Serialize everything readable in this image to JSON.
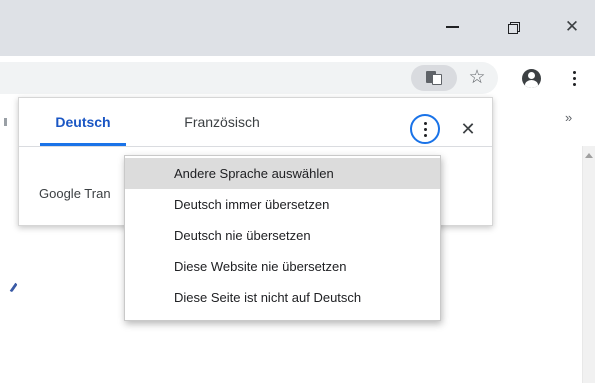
{
  "window_controls": {
    "minimize_icon": "minimize-icon",
    "restore_icon": "restore-icon",
    "close_glyph": "✕"
  },
  "toolbar": {
    "translate_icon": "translate-icon",
    "star_glyph": "☆",
    "profile_icon": "account-icon",
    "menu_icon": "more-vert-icon",
    "bookmarks_overflow": "»"
  },
  "translate_bubble": {
    "tabs": [
      {
        "label": "Deutsch",
        "selected": true
      },
      {
        "label": "Französisch",
        "selected": false
      }
    ],
    "close_glyph": "✕",
    "footer_text": "Google Tran",
    "accent_color": "#1a73e8"
  },
  "options_menu": {
    "items": [
      {
        "label": "Andere Sprache auswählen",
        "highlighted": true
      },
      {
        "label": "Deutsch immer übersetzen",
        "highlighted": false
      },
      {
        "label": "Deutsch nie übersetzen",
        "highlighted": false
      },
      {
        "label": "Diese Website nie übersetzen",
        "highlighted": false
      },
      {
        "label": "Diese Seite ist nicht auf Deutsch",
        "highlighted": false
      }
    ]
  }
}
